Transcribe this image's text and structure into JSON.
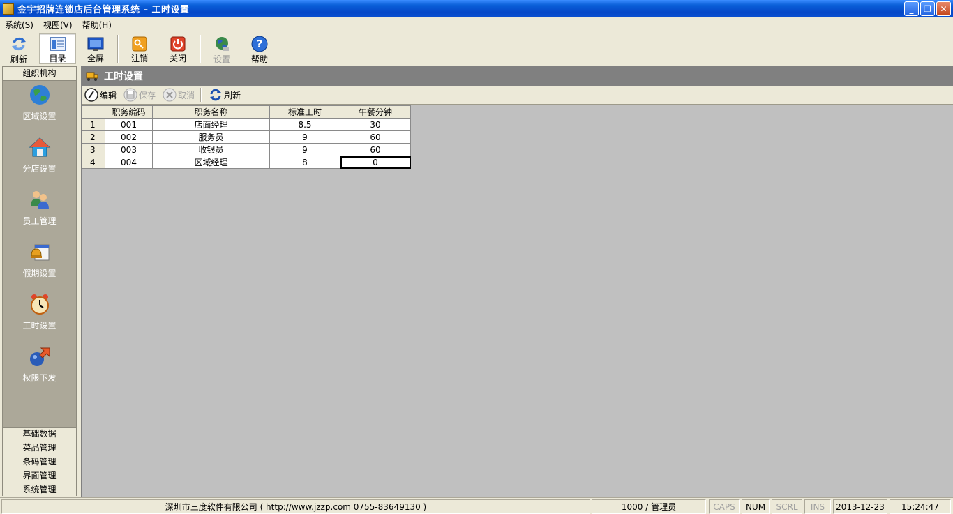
{
  "window": {
    "title": "金宇招牌连锁店后台管理系统 – 工时设置"
  },
  "menubar": [
    "系统(S)",
    "视图(V)",
    "帮助(H)"
  ],
  "toolbar": [
    {
      "label": "刷新",
      "icon": "refresh-icon"
    },
    {
      "label": "目录",
      "icon": "directory-icon",
      "active": true
    },
    {
      "label": "全屏",
      "icon": "fullscreen-icon"
    },
    {
      "label": "注销",
      "icon": "logout-icon"
    },
    {
      "label": "关闭",
      "icon": "power-icon"
    },
    {
      "label": "设置",
      "icon": "globe-settings-icon",
      "disabled": true
    },
    {
      "label": "帮助",
      "icon": "help-icon"
    }
  ],
  "sidebar": {
    "header": "组织机构",
    "items": [
      {
        "label": "区域设置",
        "icon": "globe-icon"
      },
      {
        "label": "分店设置",
        "icon": "house-icon"
      },
      {
        "label": "员工管理",
        "icon": "users-icon"
      },
      {
        "label": "假期设置",
        "icon": "calendar-bell-icon"
      },
      {
        "label": "工时设置",
        "icon": "alarm-clock-icon"
      },
      {
        "label": "权限下发",
        "icon": "permission-icon"
      }
    ],
    "footer": [
      "基础数据",
      "菜品管理",
      "条码管理",
      "界面管理",
      "系统管理"
    ]
  },
  "main": {
    "title": "工时设置",
    "subtoolbar": {
      "edit": "编辑",
      "save": "保存",
      "cancel": "取消",
      "refresh": "刷新"
    },
    "table": {
      "columns": [
        "职务编码",
        "职务名称",
        "标准工时",
        "午餐分钟"
      ],
      "rows": [
        {
          "n": "1",
          "code": "001",
          "name": "店面经理",
          "hours": "8.5",
          "lunch": "30"
        },
        {
          "n": "2",
          "code": "002",
          "name": "服务员",
          "hours": "9",
          "lunch": "60"
        },
        {
          "n": "3",
          "code": "003",
          "name": "收银员",
          "hours": "9",
          "lunch": "60"
        },
        {
          "n": "4",
          "code": "004",
          "name": "区域经理",
          "hours": "8",
          "lunch": "0"
        }
      ]
    }
  },
  "statusbar": {
    "company": "深圳市三度软件有限公司 ( http://www.jzzp.com  0755-83649130 )",
    "user": "1000 / 管理员",
    "caps": "CAPS",
    "num": "NUM",
    "scrl": "SCRL",
    "ins": "INS",
    "date": "2013-12-23",
    "time": "15:24:47"
  }
}
